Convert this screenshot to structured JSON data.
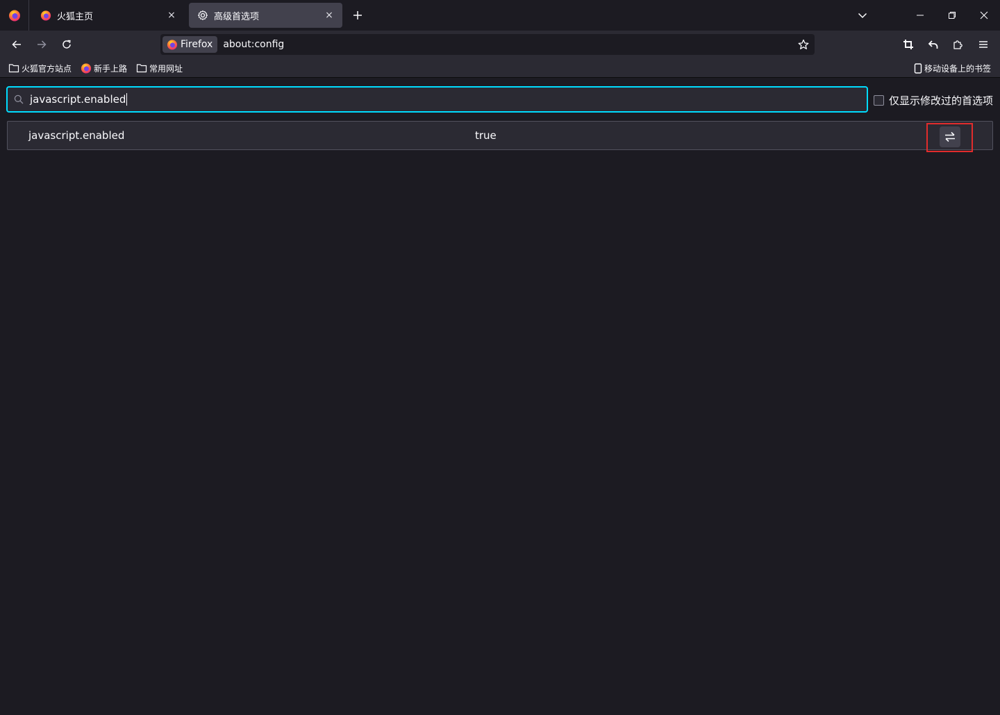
{
  "tabs": [
    {
      "title": "火狐主页",
      "close": "×"
    },
    {
      "title": "高级首选项",
      "close": "×"
    }
  ],
  "new_tab_label": "+",
  "urlbar": {
    "identity_label": "Firefox",
    "url": "about:config"
  },
  "bookmarks": [
    {
      "label": "火狐官方站点",
      "icon": "folder-icon"
    },
    {
      "label": "新手上路",
      "icon": "firefox-icon"
    },
    {
      "label": "常用网址",
      "icon": "folder-icon"
    }
  ],
  "mobile_bookmarks_label": "移动设备上的书签",
  "config": {
    "search_value": "javascript.enabled",
    "only_modified_label": "仅显示修改过的首选项",
    "only_modified_checked": false,
    "prefs": [
      {
        "name": "javascript.enabled",
        "value": "true"
      }
    ]
  },
  "colors": {
    "accent_focus": "#00ddff",
    "highlight_box": "#e22c2c",
    "background": "#1c1b22"
  }
}
